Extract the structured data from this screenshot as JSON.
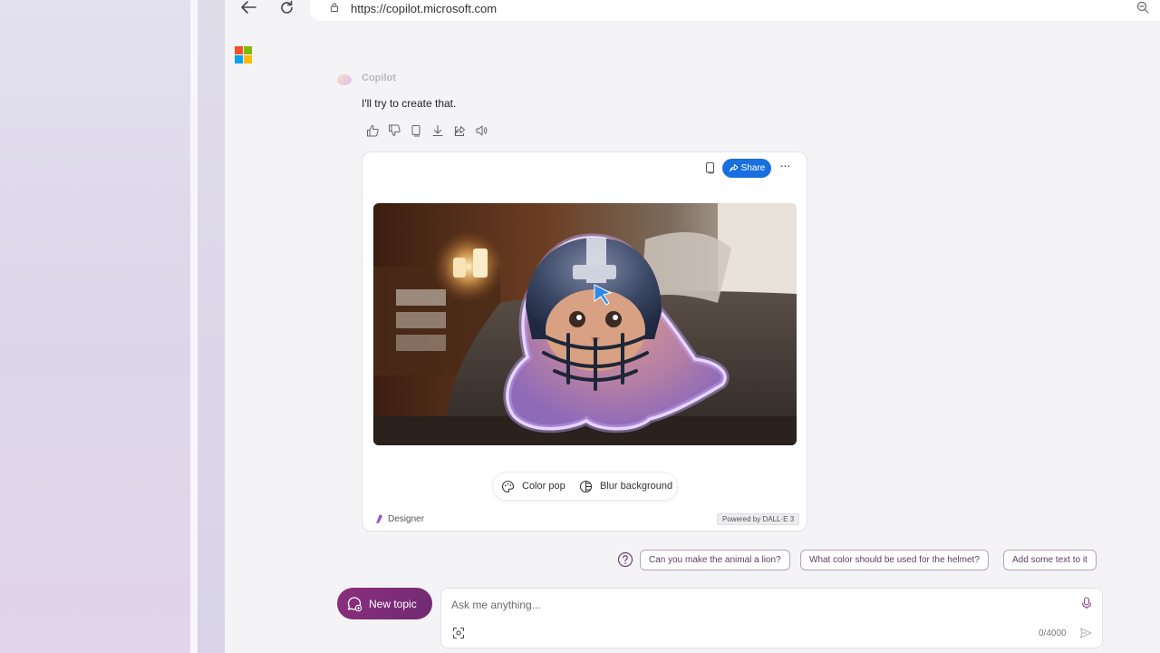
{
  "browser": {
    "url": "https://copilot.microsoft.com",
    "back_icon": "back-arrow-icon",
    "reload_icon": "reload-icon",
    "lock_icon": "lock-icon",
    "zoom_icon": "zoom-icon"
  },
  "chat": {
    "assistant_name": "Copilot",
    "message": "I'll try to create that.",
    "action_icons": [
      "thumbs-up-icon",
      "thumbs-down-icon",
      "copy-icon",
      "download-icon",
      "share-icon",
      "speaker-icon"
    ]
  },
  "image_card": {
    "share_label": "Share",
    "more_label": "···",
    "effects": [
      "Color pop",
      "Blur background"
    ],
    "designer_label": "Designer",
    "powered_by": "Powered by DALL·E 3"
  },
  "suggestions": [
    "Can you make the animal a lion?",
    "What color should be used for the helmet?",
    "Add some text to it"
  ],
  "composer": {
    "new_topic_label": "New topic",
    "placeholder": "Ask me anything...",
    "counter": "0/4000"
  },
  "colors": {
    "accent_share": "#1a6fdf",
    "new_topic": "#7d2d78",
    "suggestion_border": "#b8a3bb"
  }
}
